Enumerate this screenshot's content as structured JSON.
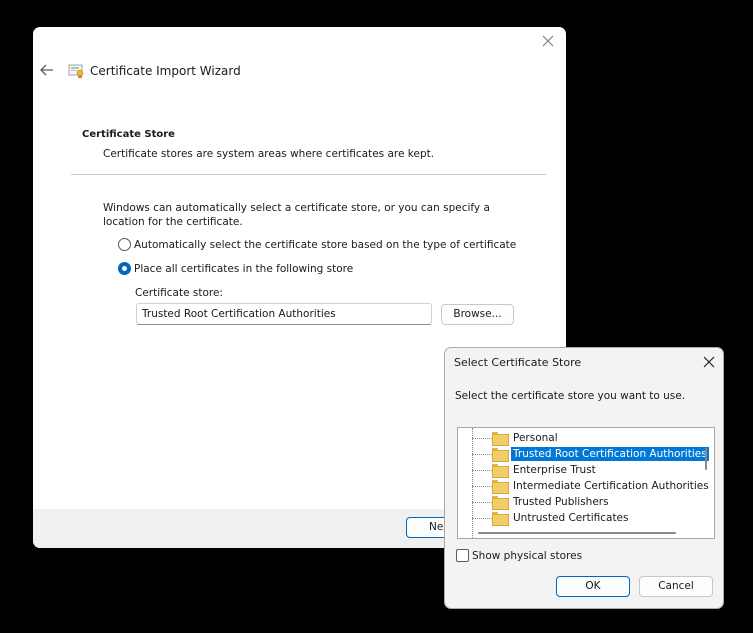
{
  "wizard": {
    "title": "Certificate Import Wizard",
    "section_title": "Certificate Store",
    "section_description": "Certificate stores are system areas where certificates are kept.",
    "intro": "Windows can automatically select a certificate store, or you can specify a location for the certificate.",
    "options": [
      {
        "label": "Automatically select the certificate store based on the type of certificate",
        "checked": false
      },
      {
        "label": "Place all certificates in the following store",
        "checked": true
      }
    ],
    "store_label": "Certificate store:",
    "store_value": "Trusted Root Certification Authorities",
    "browse_label": "Browse...",
    "next_label": "Next"
  },
  "dialog": {
    "title": "Select Certificate Store",
    "prompt": "Select the certificate store you want to use.",
    "stores": [
      {
        "label": "Personal",
        "selected": false
      },
      {
        "label": "Trusted Root Certification Authorities",
        "selected": true
      },
      {
        "label": "Enterprise Trust",
        "selected": false
      },
      {
        "label": "Intermediate Certification Authorities",
        "selected": false
      },
      {
        "label": "Trusted Publishers",
        "selected": false
      },
      {
        "label": "Untrusted Certificates",
        "selected": false
      }
    ],
    "show_physical_label": "Show physical stores",
    "show_physical_checked": false,
    "ok_label": "OK",
    "cancel_label": "Cancel"
  },
  "icons": {
    "close": "close-icon",
    "back": "back-arrow-icon",
    "certificate": "certificate-icon",
    "folder": "folder-icon"
  },
  "colors": {
    "accent": "#0067c0",
    "selection": "#0078d7",
    "folder": "#f2cc6a"
  }
}
